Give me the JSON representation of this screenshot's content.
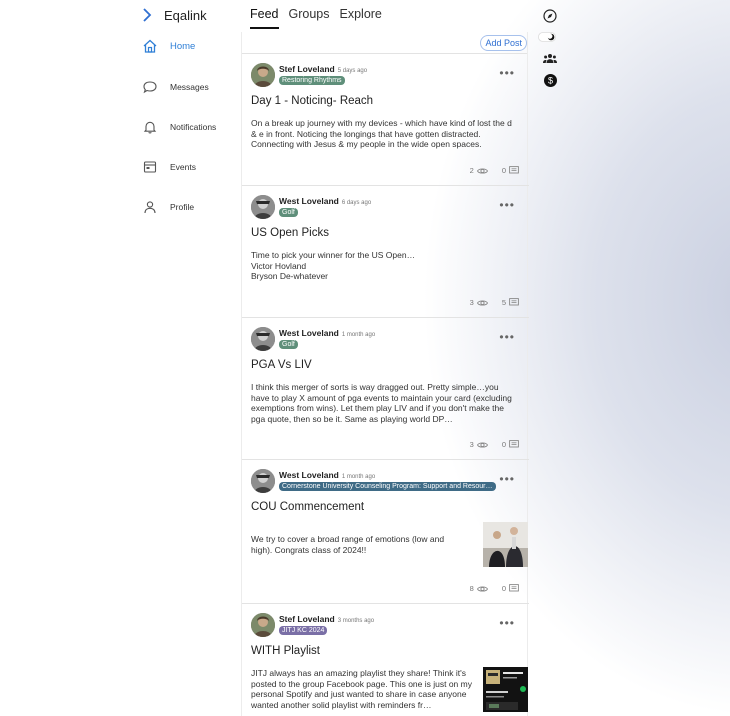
{
  "app": {
    "name": "Eqalink"
  },
  "sidebar": {
    "items": [
      {
        "label": "Home",
        "icon": "home-icon",
        "active": true
      },
      {
        "label": "Messages",
        "icon": "chat-bubble-icon"
      },
      {
        "label": "Notifications",
        "icon": "bell-icon"
      },
      {
        "label": "Events",
        "icon": "calendar-icon"
      },
      {
        "label": "Profile",
        "icon": "person-icon"
      }
    ]
  },
  "tabs": [
    {
      "label": "Feed",
      "active": true
    },
    {
      "label": "Groups"
    },
    {
      "label": "Explore"
    }
  ],
  "rail": {
    "icons": [
      "compass-icon",
      "dark-mode-toggle-icon",
      "groups-icon",
      "dollar-icon"
    ]
  },
  "feed": {
    "add_post_label": "Add Post",
    "posts": [
      {
        "author": "Stef Loveland",
        "time": "5 days ago",
        "tag": "Restoring Rhythms",
        "title": "Day 1 - Noticing- Reach",
        "body": "On a break up journey with my devices - which have kind of lost the d & e in front.  Noticing the longings that have gotten distracted. Connecting with Jesus & my people in the wide open spaces.",
        "views": "2",
        "comments": "0"
      },
      {
        "author": "West Loveland",
        "time": "6 days ago",
        "tag": "Golf",
        "title": "US Open Picks",
        "body_lines": [
          "Time to pick your winner for the US Open…",
          "Victor Hovland",
          "Bryson De-whatever"
        ],
        "views": "3",
        "comments": "5"
      },
      {
        "author": "West Loveland",
        "time": "1 month ago",
        "tag": "Golf",
        "title": "PGA Vs LIV",
        "body": "I think this merger of sorts is way dragged out. Pretty simple…you have to play X amount of pga events to maintain your card (excluding exemptions from wins). Let them play LIV and if you don't make the pga quote, then so be it. Same as playing world DP…",
        "views": "3",
        "comments": "0"
      },
      {
        "author": "West Loveland",
        "time": "1 month ago",
        "tag": "Cornerstone University Counseling Program: Support and Resources",
        "title": "COU Commencement",
        "body": "We try to cover a broad range of emotions (low and high). Congrats class of 2024!!",
        "views": "8",
        "comments": "0"
      },
      {
        "author": "Stef Loveland",
        "time": "3 months ago",
        "tag": "JITJ KC 2024",
        "title": "WITH Playlist",
        "body": "JITJ always has an amazing playlist they share! Think it's posted to the group Facebook page. This one is just on my personal Spotify and just wanted to share in case anyone wanted another solid playlist with reminders fr…"
      }
    ]
  },
  "colors": {
    "accent": "#2f7fd6",
    "tag_green": "#5f8f7a",
    "tag_purple": "#7a6fa6",
    "tag_blue": "#3f6b86"
  }
}
